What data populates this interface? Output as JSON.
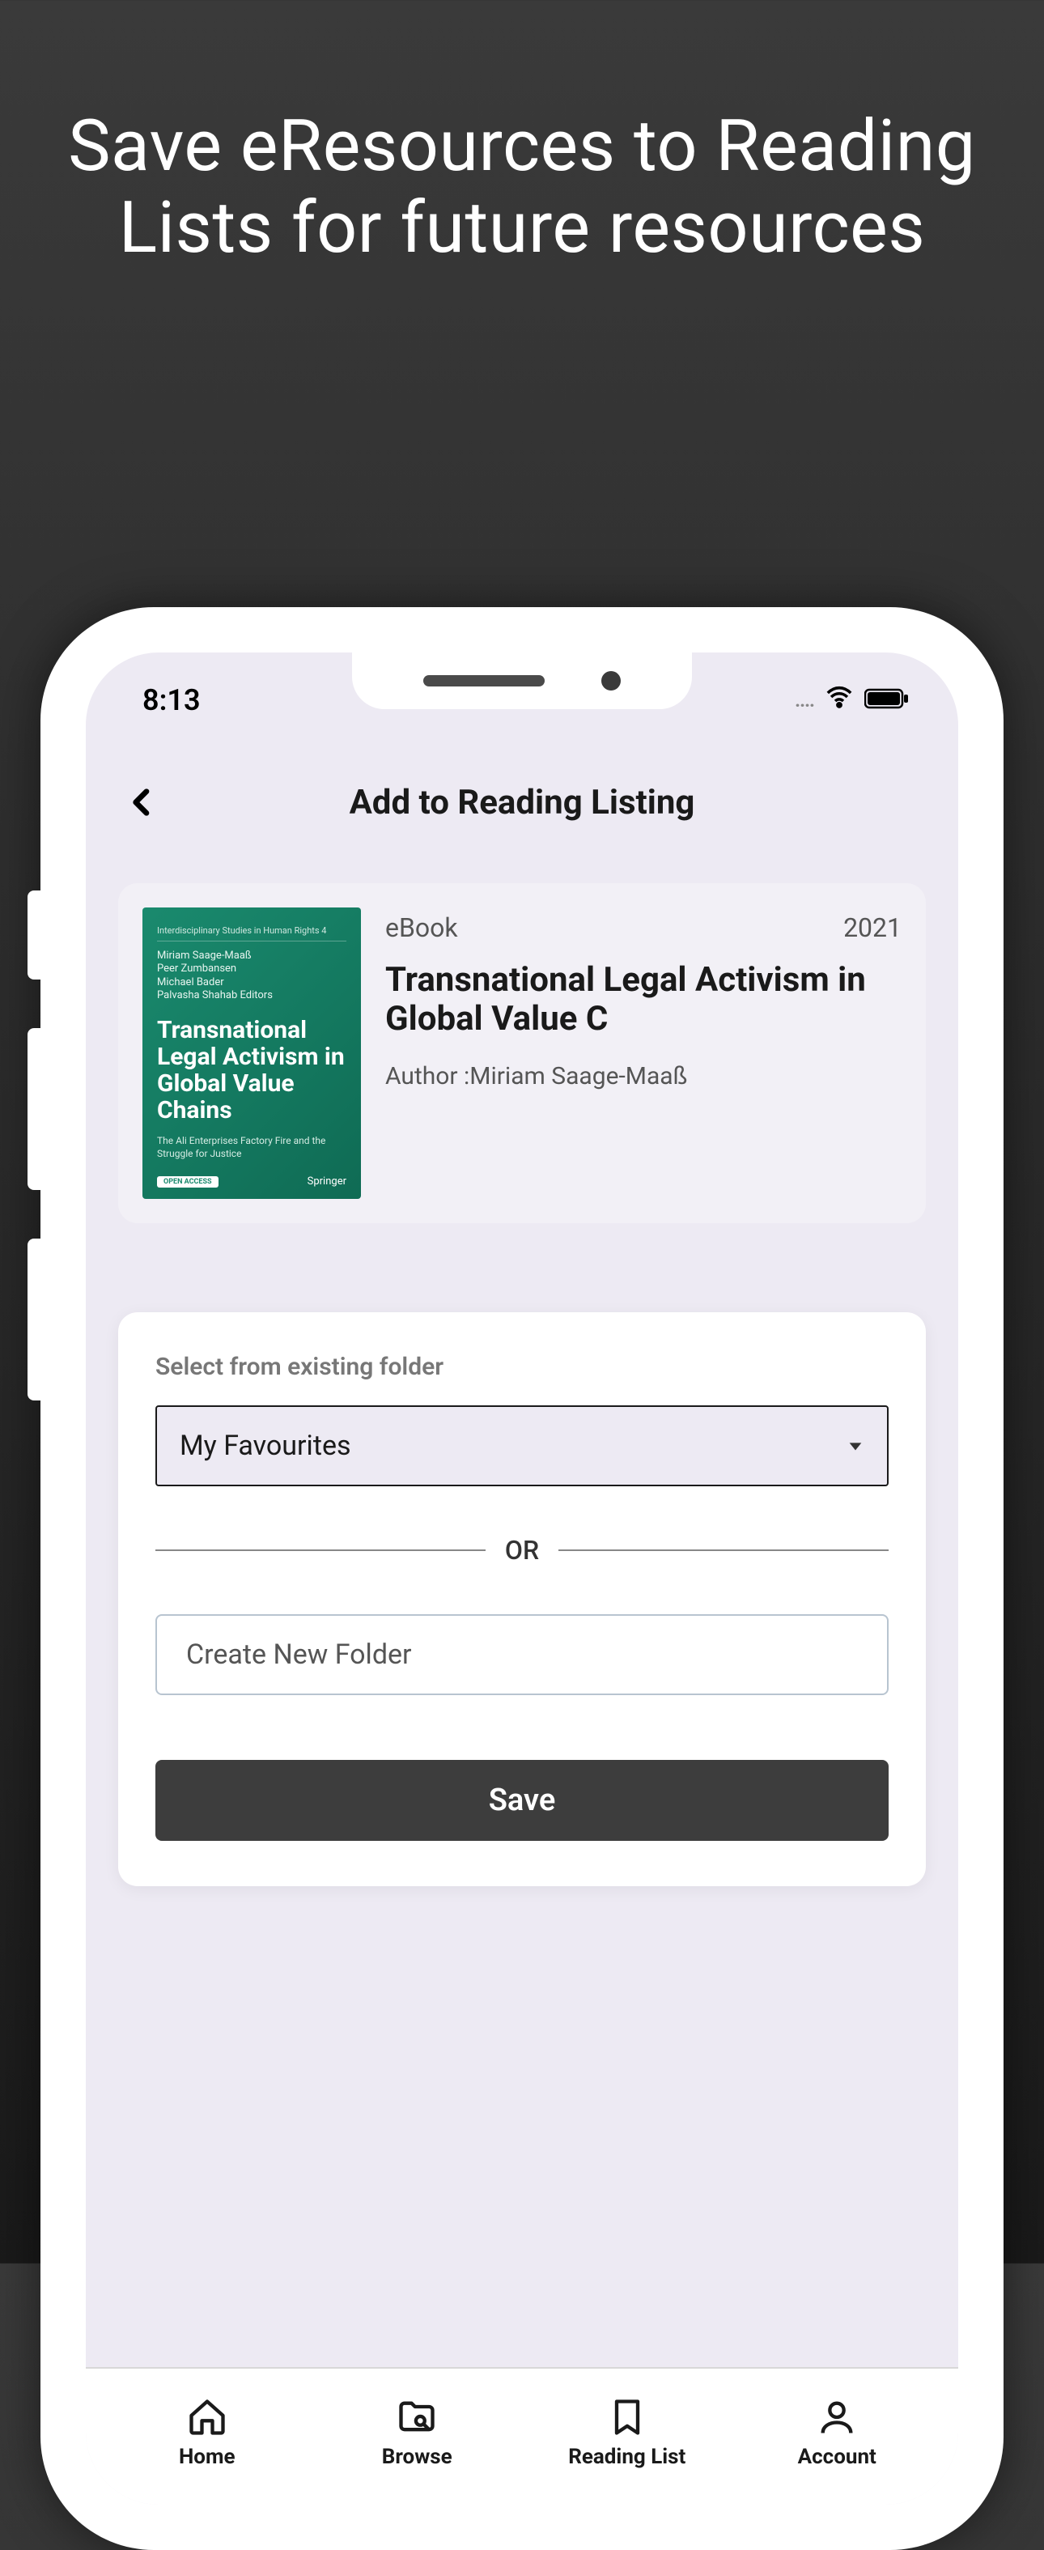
{
  "promo": "Save eResources to Reading Lists for future resources",
  "status": {
    "time": "8:13"
  },
  "nav": {
    "title": "Add to Reading Listing"
  },
  "book": {
    "type": "eBook",
    "year": "2021",
    "title": "Transnational Legal Activism in Global Value C",
    "author_label": "Author :Miriam Saage-Maaß",
    "cover": {
      "series": "Interdisciplinary Studies in Human Rights   4",
      "authors": "Miriam Saage-Maaß\nPeer Zumbansen\nMichael Bader\nPalvasha Shahab   Editors",
      "title": "Transnational Legal Activism in Global Value Chains",
      "subtitle": "The Ali Enterprises Factory Fire and the Struggle for Justice",
      "open": "OPEN ACCESS",
      "publisher": "Springer"
    }
  },
  "form": {
    "existing_label": "Select from existing folder",
    "selected": "My Favourites",
    "or": "OR",
    "new_placeholder": "Create New Folder",
    "save": "Save"
  },
  "tabs": {
    "home": "Home",
    "browse": "Browse",
    "reading": "Reading List",
    "account": "Account"
  }
}
